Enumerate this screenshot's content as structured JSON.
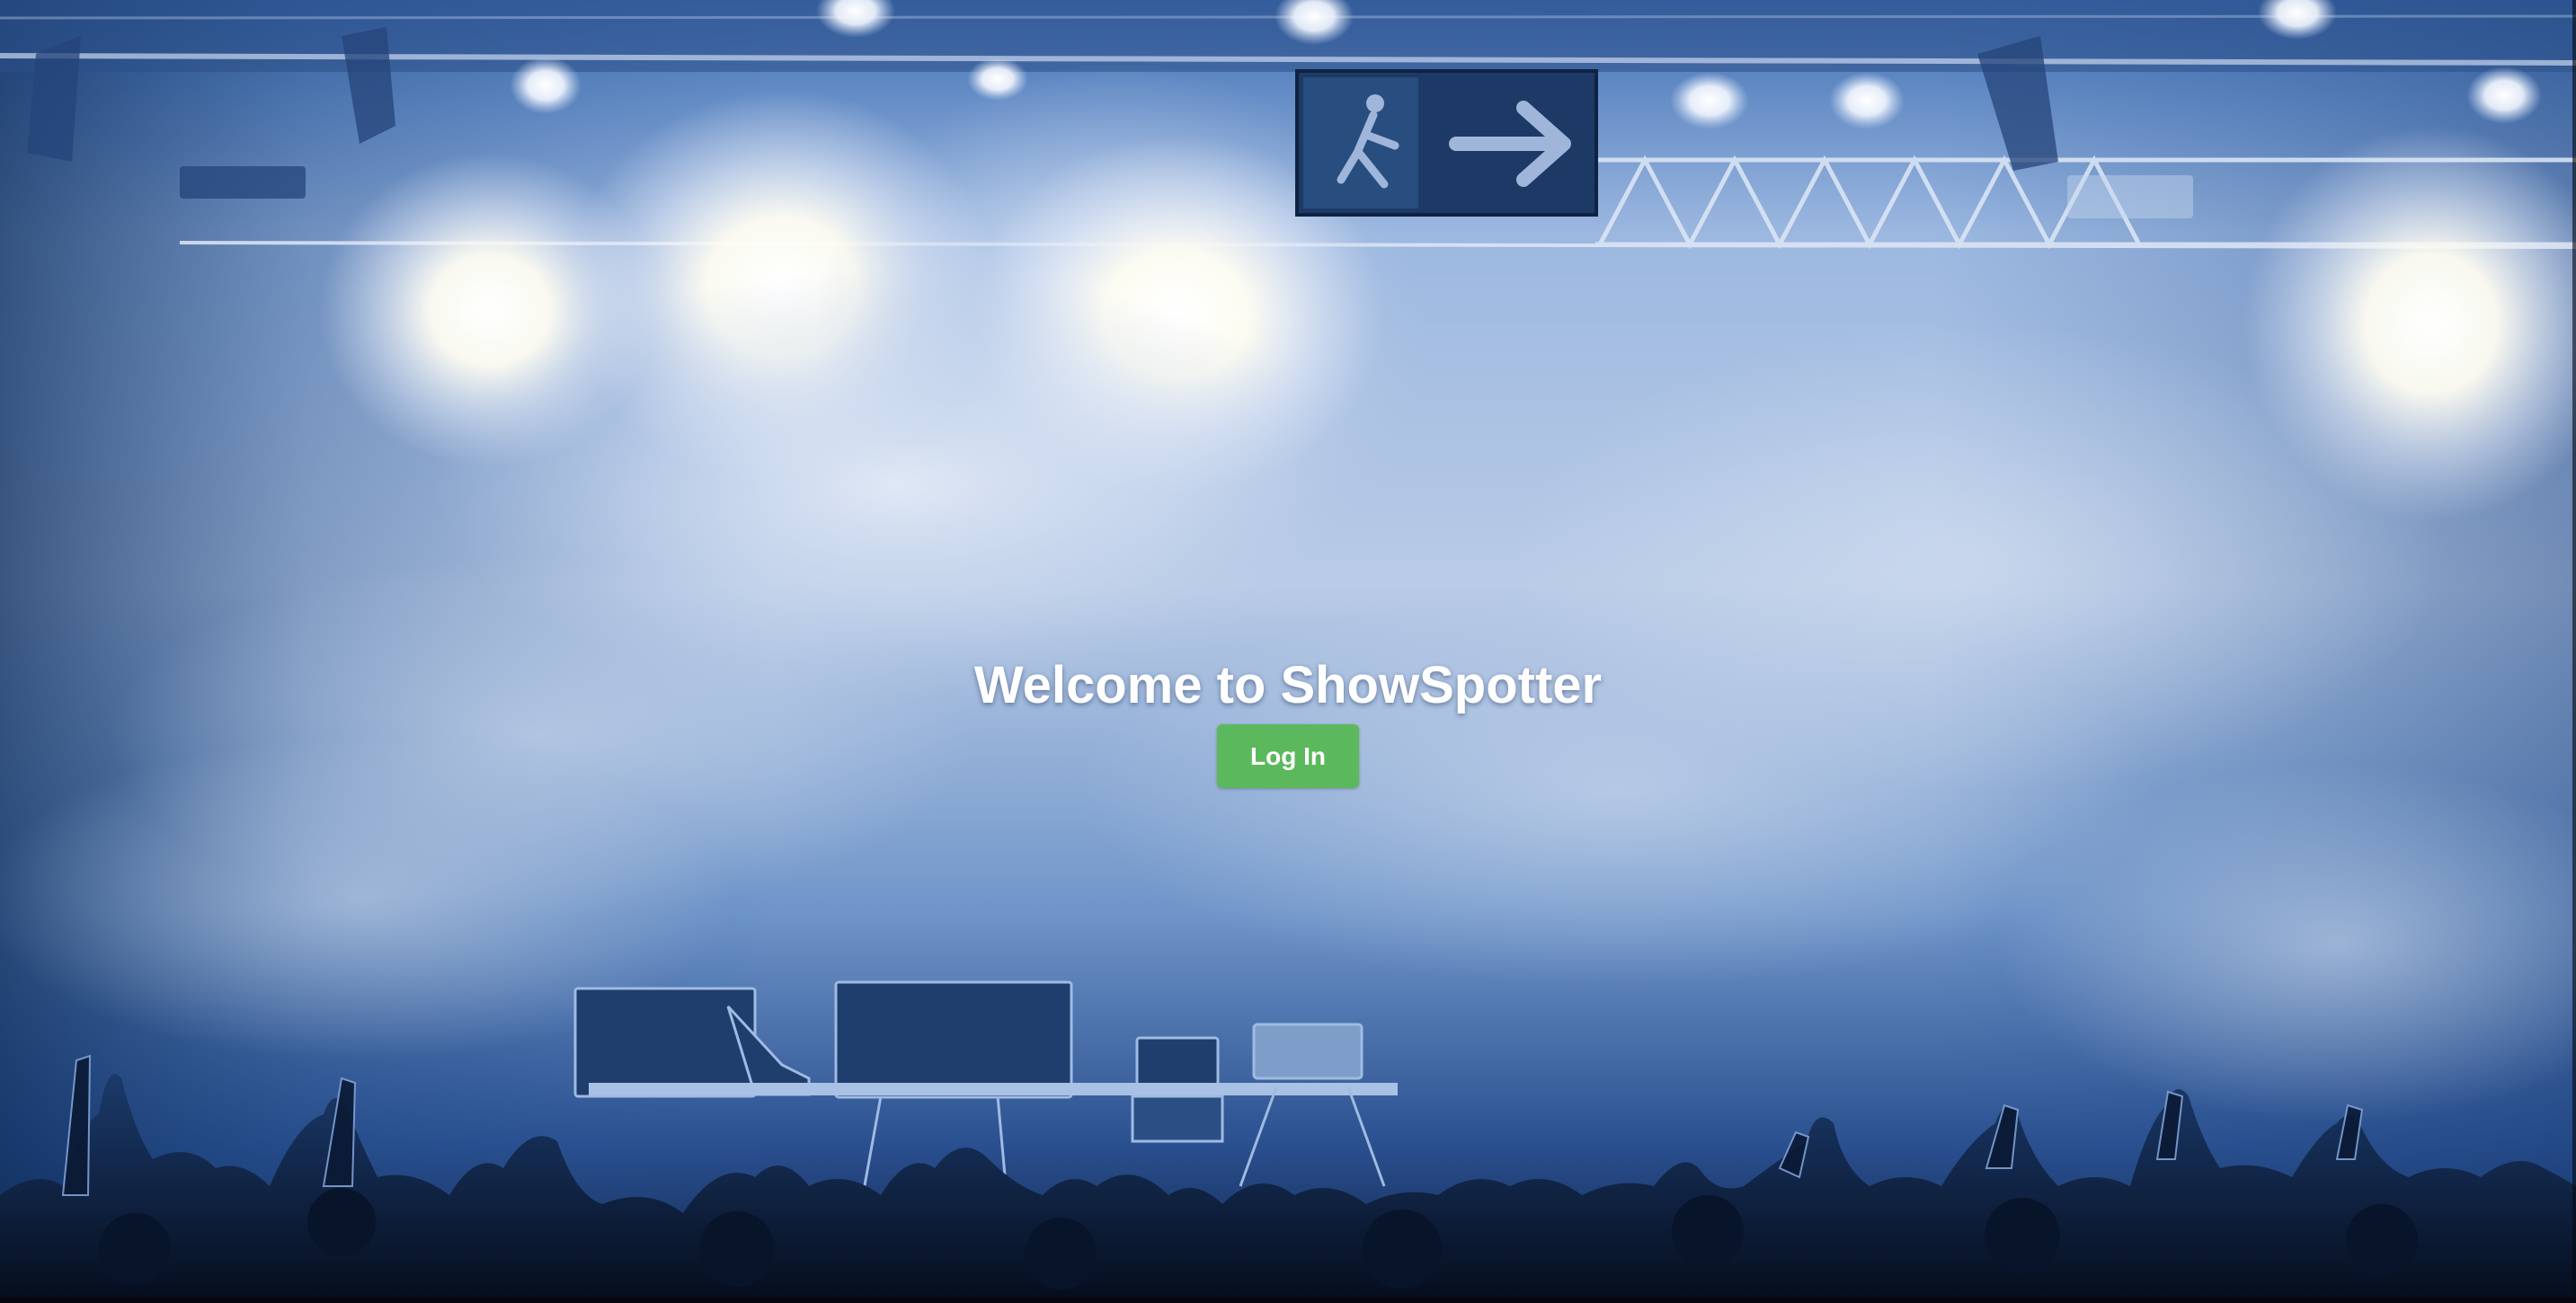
{
  "app": {
    "name": "ShowSpotter"
  },
  "hero": {
    "title": "Welcome to ShowSpotter",
    "login_label": "Log In"
  },
  "colors": {
    "login_button": "#5cb85c",
    "title_text": "#ffffff",
    "background_tone": "#2d5fa8"
  },
  "icons": {
    "exit_sign": "exit-sign-arrow"
  }
}
